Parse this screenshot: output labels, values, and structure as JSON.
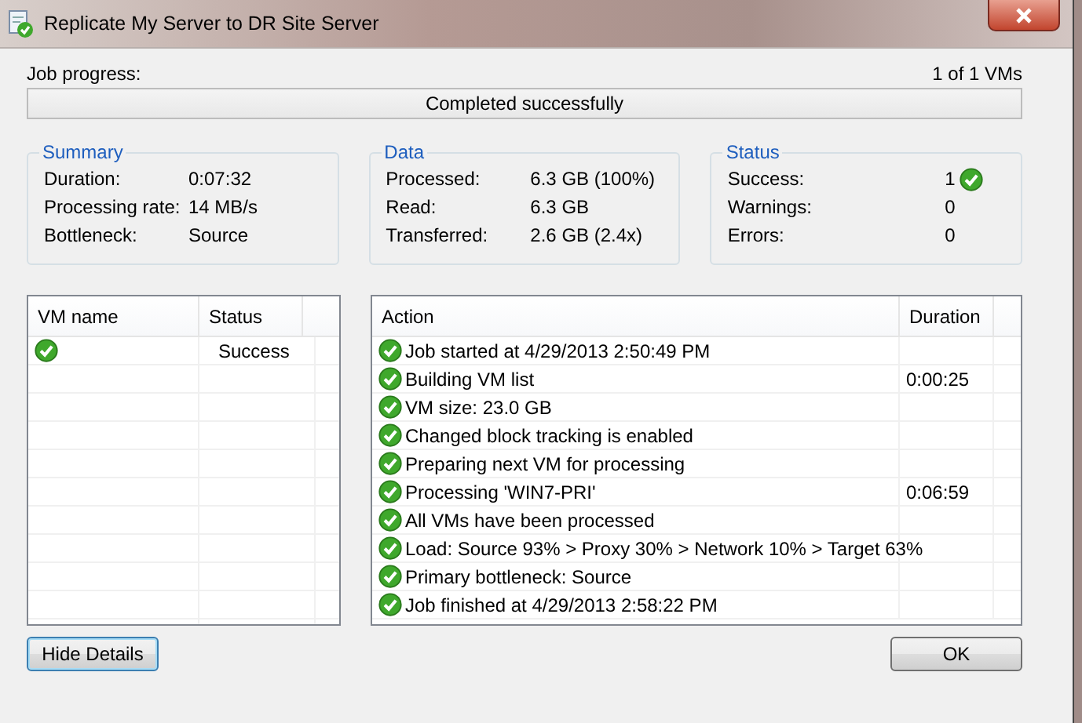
{
  "window": {
    "title": "Replicate My Server to DR Site Server"
  },
  "progress": {
    "label": "Job progress:",
    "count": "1 of 1 VMs",
    "text": "Completed successfully",
    "level": 1
  },
  "groups": [
    {
      "title": "Summary",
      "rows": [
        {
          "label": "Duration:",
          "value": "0:07:32"
        },
        {
          "label": "Processing rate:",
          "value": "14 MB/s"
        },
        {
          "label": "Bottleneck:",
          "value": "Source"
        }
      ]
    },
    {
      "title": "Data",
      "rows": [
        {
          "label": "Processed:",
          "value": "6.3 GB (100%)"
        },
        {
          "label": "Read:",
          "value": "6.3 GB"
        },
        {
          "label": "Transferred:",
          "value": "2.6 GB (2.4x)"
        }
      ]
    },
    {
      "title": "Status",
      "rows": [
        {
          "label": "Success:",
          "value": "1",
          "ok": true
        },
        {
          "label": "Warnings:",
          "value": "0",
          "ok": false
        },
        {
          "label": "Errors:",
          "value": "0",
          "ok": false
        }
      ]
    }
  ],
  "vm_table": {
    "columns": [
      "VM name",
      "Status"
    ],
    "rows": [
      {
        "status": "Success"
      }
    ]
  },
  "action_table": {
    "columns": [
      "Action",
      "Duration"
    ],
    "rows": [
      {
        "action": "Job started at 4/29/2013 2:50:49 PM"
      },
      {
        "action": "Building VM list",
        "duration": "0:00:25"
      },
      {
        "action": "VM size: 23.0 GB"
      },
      {
        "action": "Changed block tracking is enabled"
      },
      {
        "action": "Preparing next VM for processing"
      },
      {
        "action": "Processing 'WIN7-PRI'",
        "duration": "0:06:59"
      },
      {
        "action": "All VMs have been processed"
      },
      {
        "action": "Load: Source 93% > Proxy 30% > Network 10% > Target 63%"
      },
      {
        "action": "Primary bottleneck: Source"
      },
      {
        "action": "Job finished at 4/29/2013 2:58:22 PM"
      }
    ]
  },
  "buttons": [
    "Hide Details",
    "OK"
  ]
}
